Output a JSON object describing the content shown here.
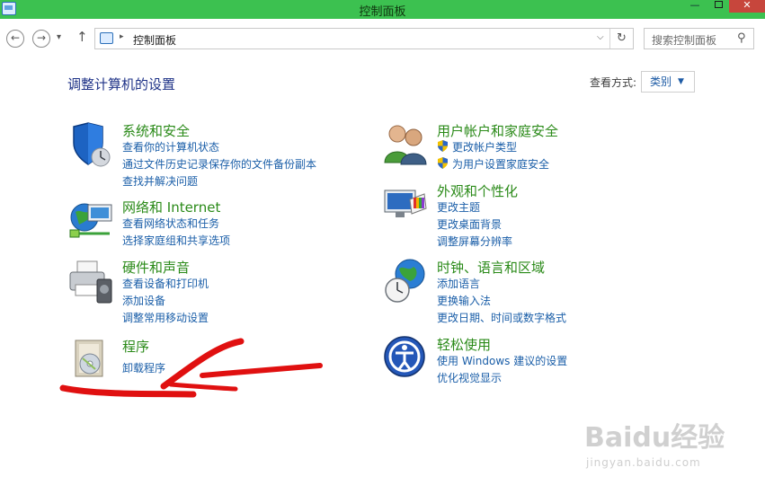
{
  "window": {
    "title": "控制面板",
    "close_glyph": "✕",
    "min_glyph": "—"
  },
  "nav": {
    "back_glyph": "←",
    "forward_glyph": "→",
    "recent_glyph": "▾",
    "up_glyph": "↑",
    "address_sep": "▸",
    "address_path": "控制面板",
    "address_dropdown": "⌵",
    "refresh_glyph": "↻",
    "search_placeholder": "搜索控制面板",
    "search_glyph": "⚲"
  },
  "main": {
    "heading": "调整计算机的设置",
    "view_by_label": "查看方式:",
    "view_by_value": "类别",
    "view_by_caret": "▼"
  },
  "categories_left": [
    {
      "title": "系统和安全",
      "icon": "shield-icon",
      "links": [
        "查看你的计算机状态",
        "通过文件历史记录保存你的文件备份副本",
        "查找并解决问题"
      ]
    },
    {
      "title": "网络和 Internet",
      "icon": "network-icon",
      "links": [
        "查看网络状态和任务",
        "选择家庭组和共享选项"
      ]
    },
    {
      "title": "硬件和声音",
      "icon": "printer-icon",
      "links": [
        "查看设备和打印机",
        "添加设备",
        "调整常用移动设置"
      ]
    },
    {
      "title": "程序",
      "icon": "programs-icon",
      "links": [
        "卸载程序"
      ]
    }
  ],
  "categories_right": [
    {
      "title": "用户帐户和家庭安全",
      "icon": "users-icon",
      "links": [
        "更改帐户类型",
        "为用户设置家庭安全"
      ]
    },
    {
      "title": "外观和个性化",
      "icon": "appearance-icon",
      "links": [
        "更改主题",
        "更改桌面背景",
        "调整屏幕分辨率"
      ]
    },
    {
      "title": "时钟、语言和区域",
      "icon": "clock-globe-icon",
      "links": [
        "添加语言",
        "更换输入法",
        "更改日期、时间或数字格式"
      ]
    },
    {
      "title": "轻松使用",
      "icon": "ease-of-access-icon",
      "links": [
        "使用 Windows 建议的设置",
        "优化视觉显示"
      ]
    }
  ],
  "watermark": {
    "brand": "Baidu经验",
    "url": "jingyan.baidu.com"
  },
  "colors": {
    "titlebar": "#3cc150",
    "category_title": "#2a8a18",
    "link": "#1a5ea8",
    "heading": "#1e3287",
    "annotation": "#e01010"
  }
}
